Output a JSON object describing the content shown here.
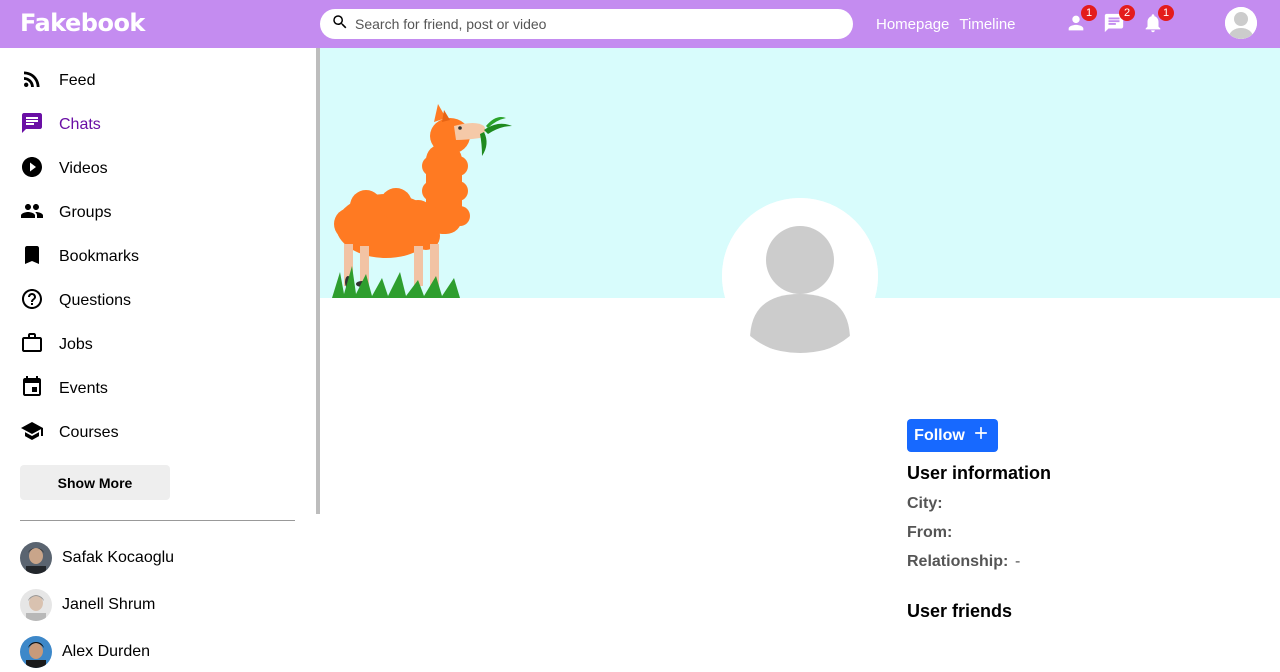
{
  "app": {
    "logo": "Fakebook"
  },
  "search": {
    "placeholder": "Search for friend, post or video"
  },
  "topnav": {
    "links": [
      "Homepage",
      "Timeline"
    ]
  },
  "notifications": {
    "friends_count": "1",
    "messages_count": "2",
    "alerts_count": "1"
  },
  "icons": {
    "search": "search-icon",
    "person": "person-icon",
    "chat": "chat-icon",
    "bell": "bell-icon",
    "feed": "rss-feed-icon",
    "chats": "chat-icon",
    "videos": "play-circle-icon",
    "groups": "group-icon",
    "bookmarks": "bookmark-icon",
    "questions": "help-circle-icon",
    "jobs": "briefcase-icon",
    "events": "calendar-icon",
    "courses": "school-icon"
  },
  "sidebar": {
    "items": [
      {
        "label": "Feed"
      },
      {
        "label": "Chats"
      },
      {
        "label": "Videos"
      },
      {
        "label": "Groups"
      },
      {
        "label": "Bookmarks"
      },
      {
        "label": "Questions"
      },
      {
        "label": "Jobs"
      },
      {
        "label": "Events"
      },
      {
        "label": "Courses"
      }
    ],
    "active": "Chats",
    "show_more": "Show More",
    "friends": [
      {
        "name": "Safak Kocaoglu"
      },
      {
        "name": "Janell Shrum"
      },
      {
        "name": "Alex Durden"
      }
    ]
  },
  "profile": {
    "follow_label": "Follow",
    "info_title": "User information",
    "city_label": "City:",
    "city_value": "",
    "from_label": "From:",
    "from_value": "",
    "relationship_label": "Relationship:",
    "relationship_value": "-",
    "friends_title": "User friends"
  },
  "colors": {
    "topbar": "#c48cf0",
    "active": "#6a0fa5",
    "cover": "#d8fcfc",
    "follow_button": "#1769ff",
    "badge": "#e41c1c"
  }
}
